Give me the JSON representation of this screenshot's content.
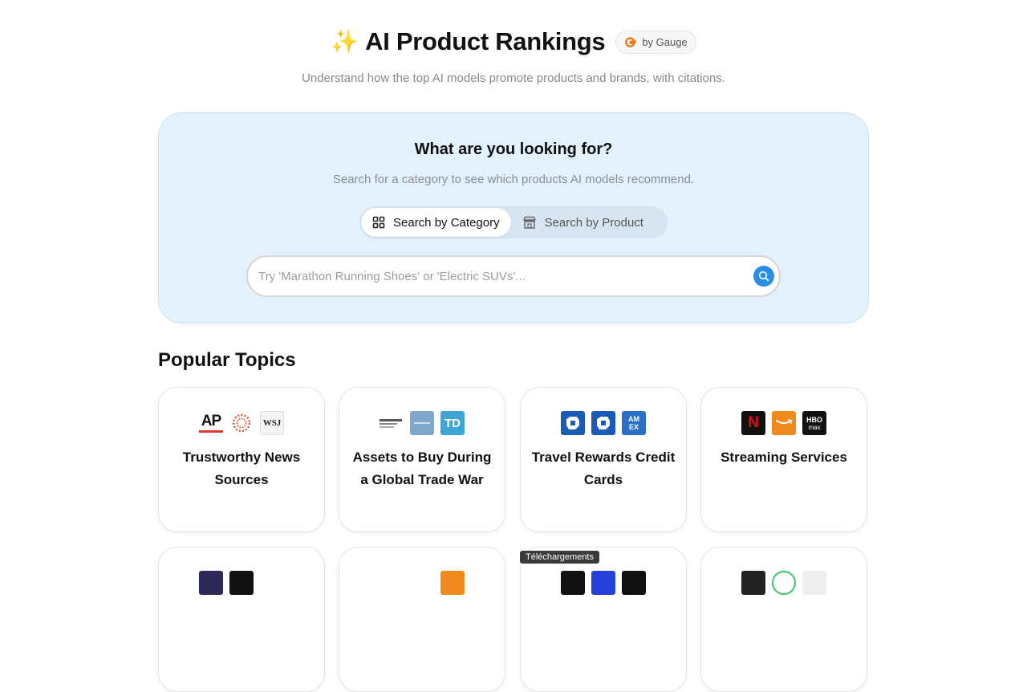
{
  "header": {
    "title": "AI Product Rankings",
    "badge_label": "by Gauge",
    "subtitle": "Understand how the top AI models promote products and brands, with citations."
  },
  "hero": {
    "title": "What are you looking for?",
    "subtitle": "Search for a category to see which products AI models recommend.",
    "tabs": [
      {
        "label": "Search by Category",
        "active": true
      },
      {
        "label": "Search by Product",
        "active": false
      }
    ],
    "search_placeholder": "Try 'Marathon Running Shoes' or 'Electric SUVs'..."
  },
  "popular": {
    "title": "Popular Topics",
    "cards": [
      {
        "label": "Trustworthy News Sources",
        "logos": [
          "AP",
          "dotted-circle",
          "WSJ"
        ]
      },
      {
        "label": "Assets to Buy During a Global Trade War",
        "logos": [
          "text-logo",
          "blue-box",
          "TD"
        ]
      },
      {
        "label": "Travel Rewards Credit Cards",
        "logos": [
          "chase",
          "chase",
          "AMEX"
        ]
      },
      {
        "label": "Streaming Services",
        "logos": [
          "N",
          "amazon",
          "HBO max"
        ]
      }
    ]
  },
  "tooltip": "Téléchargements",
  "colors": {
    "accent": "#2a8ee6",
    "hero_bg": "#e3f1fc"
  }
}
